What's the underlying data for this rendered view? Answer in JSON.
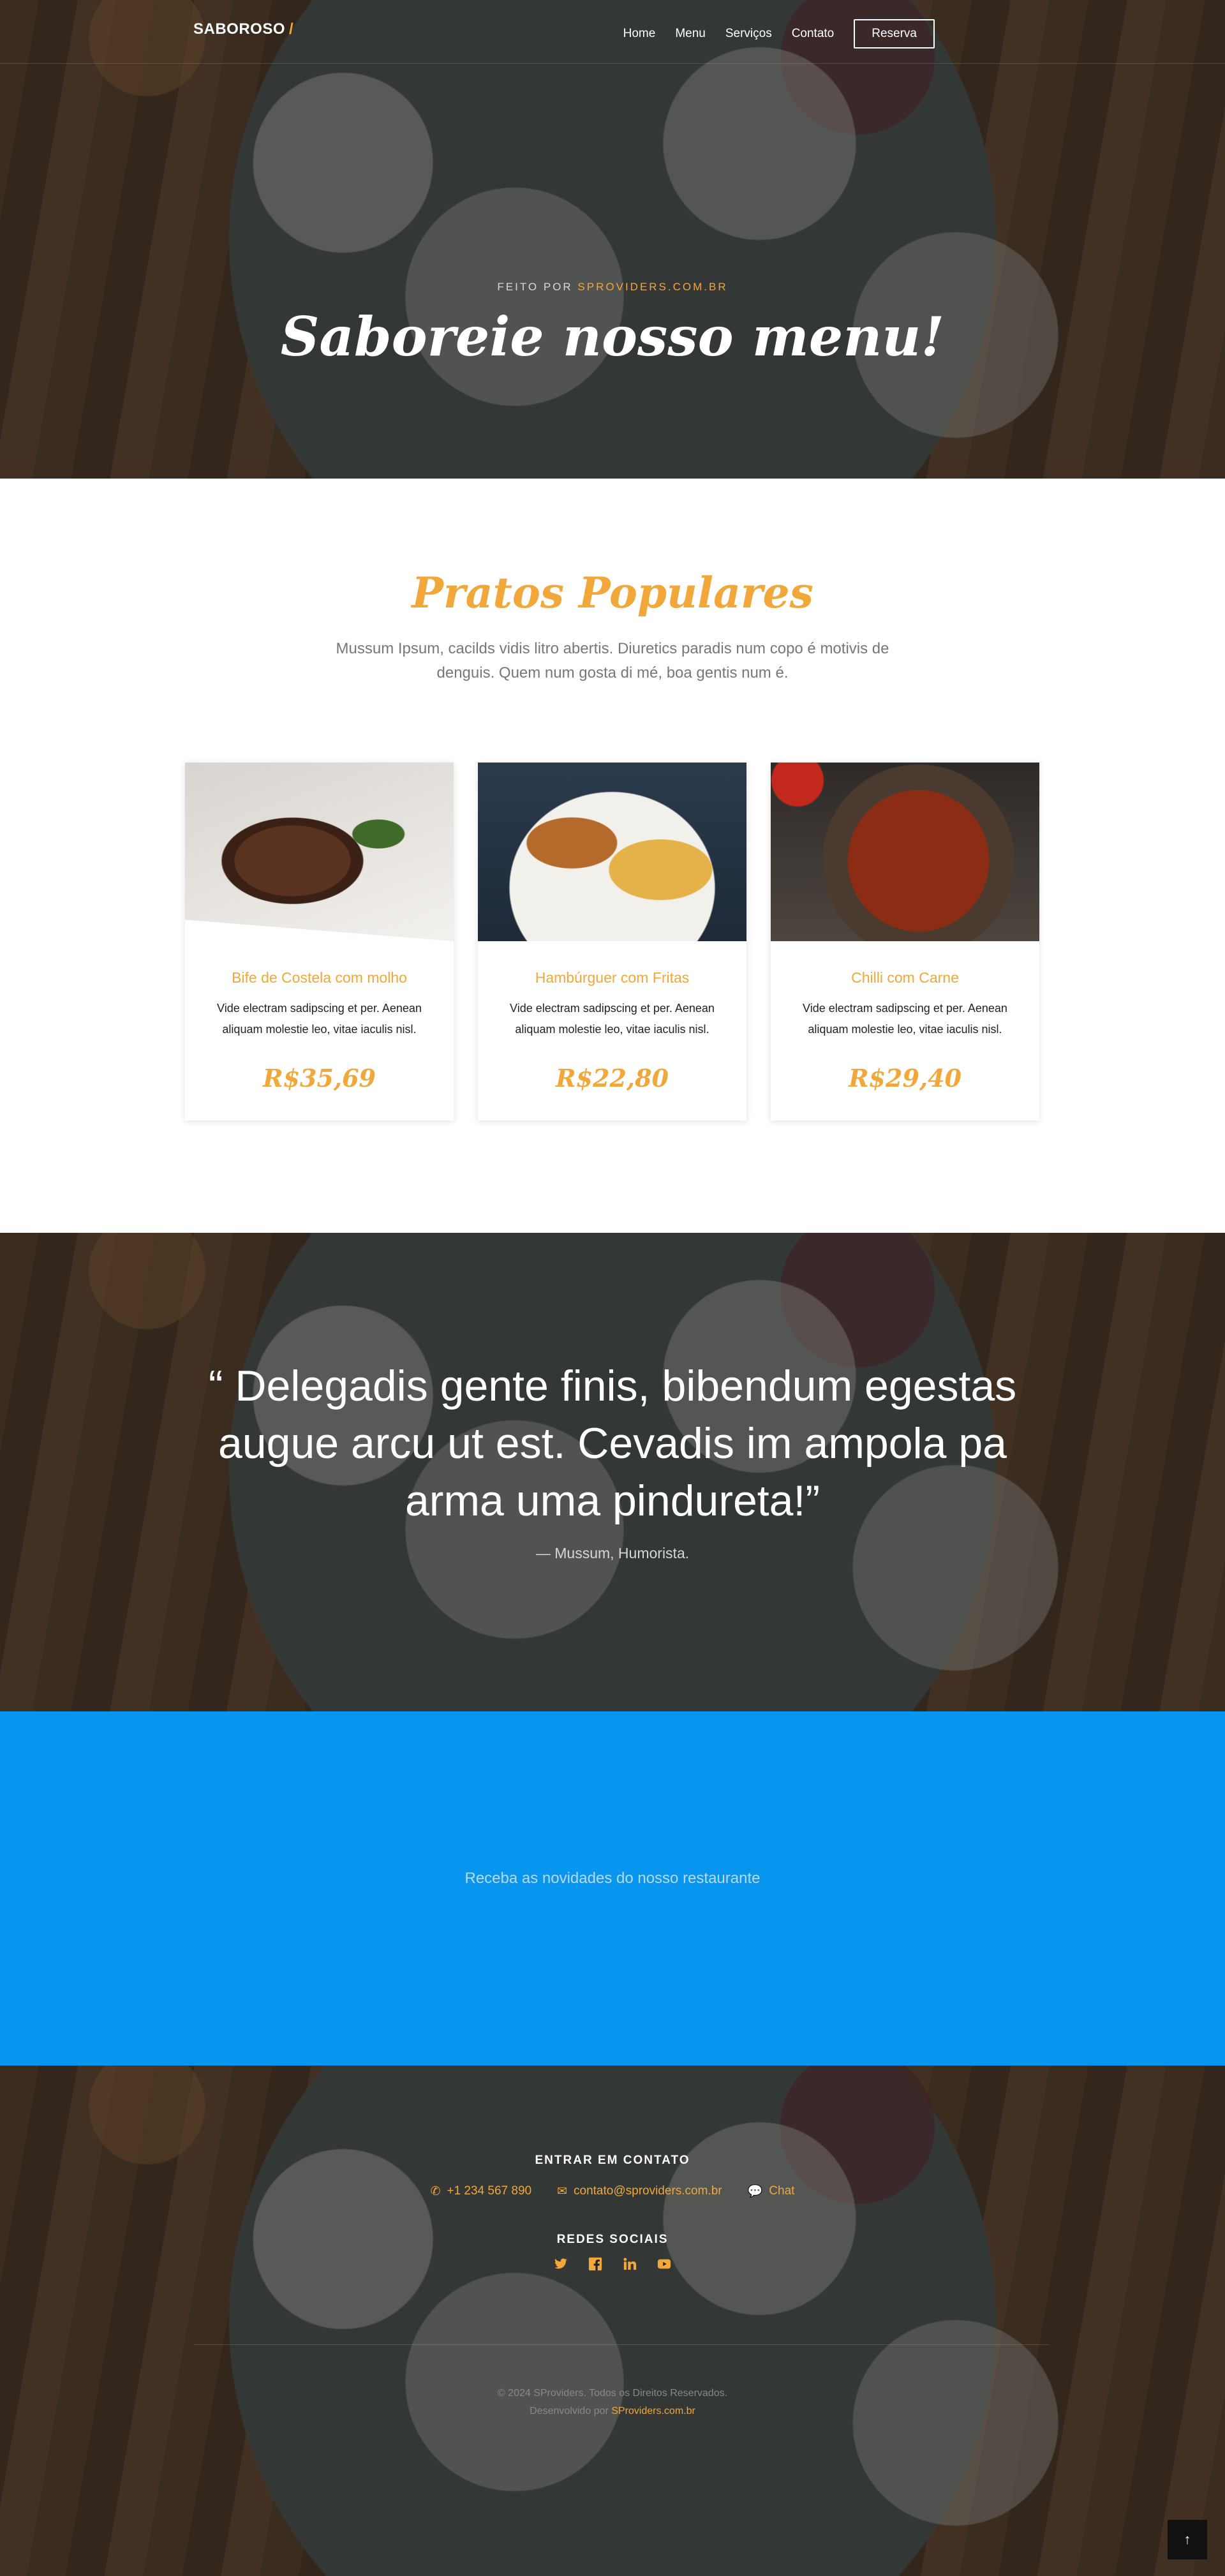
{
  "header": {
    "brand": "SABOROSO",
    "brand_accent": "/",
    "nav": [
      "Home",
      "Menu",
      "Serviços",
      "Contato"
    ],
    "reserve_button": "Reserva"
  },
  "hero": {
    "subtitle_prefix": "FEITO POR",
    "subtitle_highlight": "SPROVIDERS.COM.BR",
    "title": "Saboreie nosso menu!"
  },
  "popular": {
    "title": "Pratos Populares",
    "description": "Mussum Ipsum, cacilds vidis litro abertis. Diuretics paradis num copo é motivis de denguis. Quem num gosta di mé, boa gentis num é.",
    "items": [
      {
        "name": "Bife de Costela com molho",
        "description": "Vide electram sadipscing et per. Aenean aliquam molestie leo, vitae iaculis nisl.",
        "price": "R$35,69"
      },
      {
        "name": "Hambúrguer com Fritas",
        "description": "Vide electram sadipscing et per. Aenean aliquam molestie leo, vitae iaculis nisl.",
        "price": "R$22,80"
      },
      {
        "name": "Chilli com Carne",
        "description": "Vide electram sadipscing et per. Aenean aliquam molestie leo, vitae iaculis nisl.",
        "price": "R$29,40"
      }
    ]
  },
  "quote": {
    "text": "“ Delegadis gente finis, bibendum egestas augue arcu ut est. Cevadis im ampola pa arma uma pindureta!”",
    "author": "— Mussum, Humorista."
  },
  "newsletter": {
    "text": "Receba as novidades do nosso restaurante"
  },
  "footer": {
    "contact_heading": "ENTRAR EM CONTATO",
    "phone": "+1 234 567 890",
    "email": "contato@sproviders.com.br",
    "chat": "Chat",
    "social_heading": "REDES SOCIAIS",
    "social_icons": [
      "twitter-icon",
      "facebook-icon",
      "linkedin-icon",
      "youtube-icon"
    ],
    "copyright": "© 2024 SProviders. Todos os Direitos Reservados.",
    "dev_prefix": "Desenvolvido por",
    "dev_link": "SProviders.com.br"
  },
  "colors": {
    "accent": "#f2a73b",
    "newsletter_bg": "#0796ef"
  }
}
